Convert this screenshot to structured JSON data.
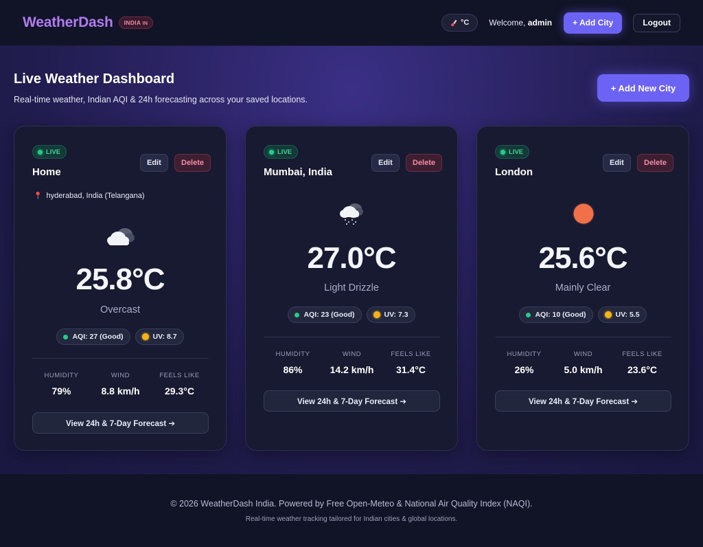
{
  "navbar": {
    "brand": "WeatherDash",
    "brand_badge": "INDIA",
    "brand_badge_flag": "IN",
    "unit_toggle": "°C",
    "welcome_prefix": "Welcome,",
    "username": "admin",
    "add_city_label": "+ Add City",
    "logout_label": "Logout"
  },
  "header": {
    "title": "Live Weather Dashboard",
    "subtitle": "Real-time weather, Indian AQI & 24h forecasting across your saved locations.",
    "add_new_city_label": "+ Add New City"
  },
  "cards": [
    {
      "status": "LIVE",
      "name": "Home",
      "location": "hyderabad, India (Telangana)",
      "icon": "overcast-cloud-icon",
      "temperature": "25.8°C",
      "condition": "Overcast",
      "aqi": "AQI: 27 (Good)",
      "uv": "UV: 8.7",
      "edit_label": "Edit",
      "delete_label": "Delete",
      "stats": [
        {
          "label": "HUMIDITY",
          "value": "79%"
        },
        {
          "label": "WIND",
          "value": "8.8 km/h"
        },
        {
          "label": "FEELS LIKE",
          "value": "29.3°C"
        }
      ],
      "forecast_label": "View 24h & 7-Day Forecast ➔"
    },
    {
      "status": "LIVE",
      "name": "Mumbai, India",
      "location": "",
      "icon": "drizzle-cloud-icon",
      "temperature": "27.0°C",
      "condition": "Light Drizzle",
      "aqi": "AQI: 23 (Good)",
      "uv": "UV: 7.3",
      "edit_label": "Edit",
      "delete_label": "Delete",
      "stats": [
        {
          "label": "HUMIDITY",
          "value": "86%"
        },
        {
          "label": "WIND",
          "value": "14.2 km/h"
        },
        {
          "label": "FEELS LIKE",
          "value": "31.4°C"
        }
      ],
      "forecast_label": "View 24h & 7-Day Forecast ➔"
    },
    {
      "status": "LIVE",
      "name": "London",
      "location": "",
      "icon": "sun-icon",
      "temperature": "25.6°C",
      "condition": "Mainly Clear",
      "aqi": "AQI: 10 (Good)",
      "uv": "UV: 5.5",
      "edit_label": "Edit",
      "delete_label": "Delete",
      "stats": [
        {
          "label": "HUMIDITY",
          "value": "26%"
        },
        {
          "label": "WIND",
          "value": "5.0 km/h"
        },
        {
          "label": "FEELS LIKE",
          "value": "23.6°C"
        }
      ],
      "forecast_label": "View 24h & 7-Day Forecast ➔"
    }
  ],
  "footer": {
    "line1": "© 2026 WeatherDash India. Powered by Free Open-Meteo & National Air Quality Index (NAQI).",
    "line2": "Real-time weather tracking tailored for Indian cities & global locations."
  },
  "colors": {
    "accent": "#6c63f5",
    "live_green": "#28c98a",
    "delete_red": "#f28ba3",
    "sun": "#f0704a"
  }
}
